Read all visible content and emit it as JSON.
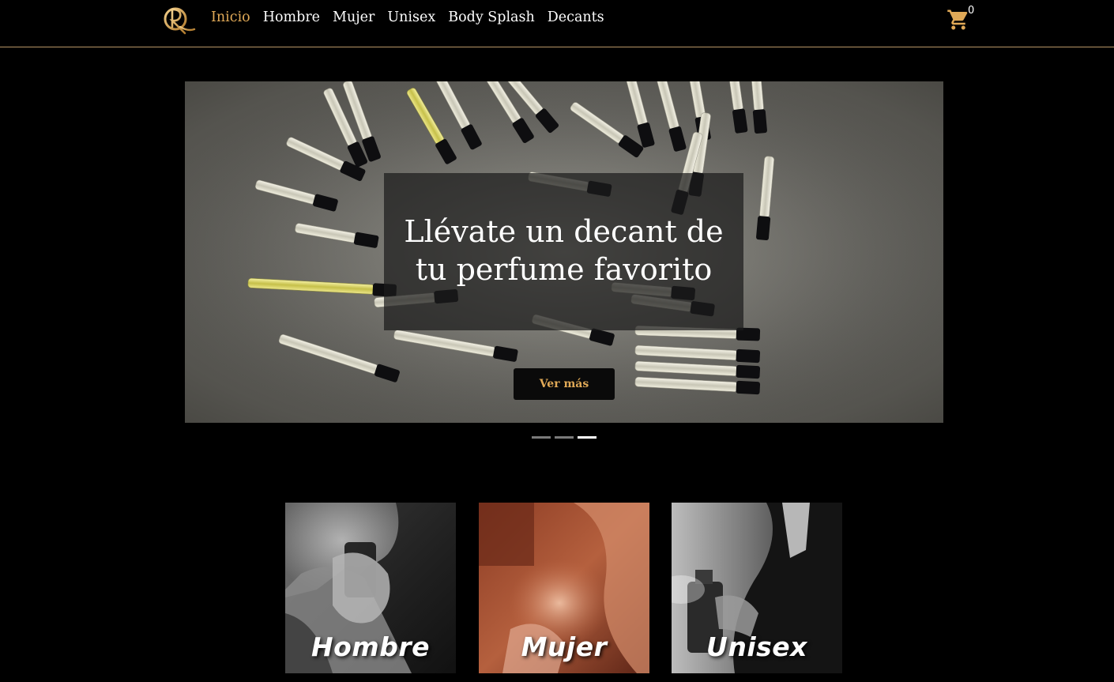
{
  "brand": {
    "logo_letters": "QR"
  },
  "nav": {
    "items": [
      {
        "label": "Inicio",
        "active": true
      },
      {
        "label": "Hombre",
        "active": false
      },
      {
        "label": "Mujer",
        "active": false
      },
      {
        "label": "Unisex",
        "active": false
      },
      {
        "label": "Body Splash",
        "active": false
      },
      {
        "label": "Decants",
        "active": false
      }
    ]
  },
  "cart": {
    "icon": "shopping-cart-icon",
    "count": "0"
  },
  "hero": {
    "title": "Llévate un decant de tu perfume favorito",
    "button_label": "Ver más",
    "slides": 3,
    "active_slide": 3
  },
  "categories": [
    {
      "label": "Hombre"
    },
    {
      "label": "Mujer"
    },
    {
      "label": "Unisex"
    }
  ],
  "colors": {
    "accent": "#e0a957",
    "background": "#000000",
    "nav_border": "#b89566",
    "text": "#ffffff"
  }
}
